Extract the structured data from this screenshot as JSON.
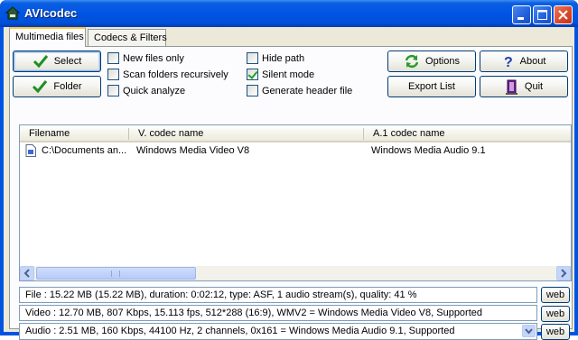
{
  "window": {
    "title": "AVIcodec"
  },
  "tabs": [
    {
      "label": "Multimedia files"
    },
    {
      "label": "Codecs & Filters"
    }
  ],
  "buttons": {
    "select": "Select",
    "folder": "Folder",
    "options": "Options",
    "about": "About",
    "export_list": "Export List",
    "quit": "Quit"
  },
  "checkboxes": [
    {
      "label": "New files only",
      "checked": false
    },
    {
      "label": "Scan folders recursively",
      "checked": false
    },
    {
      "label": "Quick analyze",
      "checked": false
    },
    {
      "label": "Hide path",
      "checked": false
    },
    {
      "label": "Silent mode",
      "checked": true
    },
    {
      "label": "Generate header file",
      "checked": false
    }
  ],
  "list": {
    "columns": [
      "Filename",
      "V. codec name",
      "A.1 codec name"
    ],
    "rows": [
      {
        "filename": "C:\\Documents an...",
        "vcodec": "Windows Media Video V8",
        "acodec": "Windows Media Audio 9.1"
      }
    ]
  },
  "info": {
    "file": "File   :  15.22 MB (15.22 MB),  duration: 0:02:12,  type: ASF,  1 audio stream(s),  quality: 41 %",
    "video": "Video :  12.70 MB,  807 Kbps,  15.113 fps,  512*288 (16:9),  WMV2 = Windows Media Video V8,    Supported",
    "audio": "Audio :  2.51 MB,  160 Kbps,  44100 Hz,  2 channels,  0x161 = Windows Media Audio 9.1,    Supported",
    "web_label": "web"
  }
}
